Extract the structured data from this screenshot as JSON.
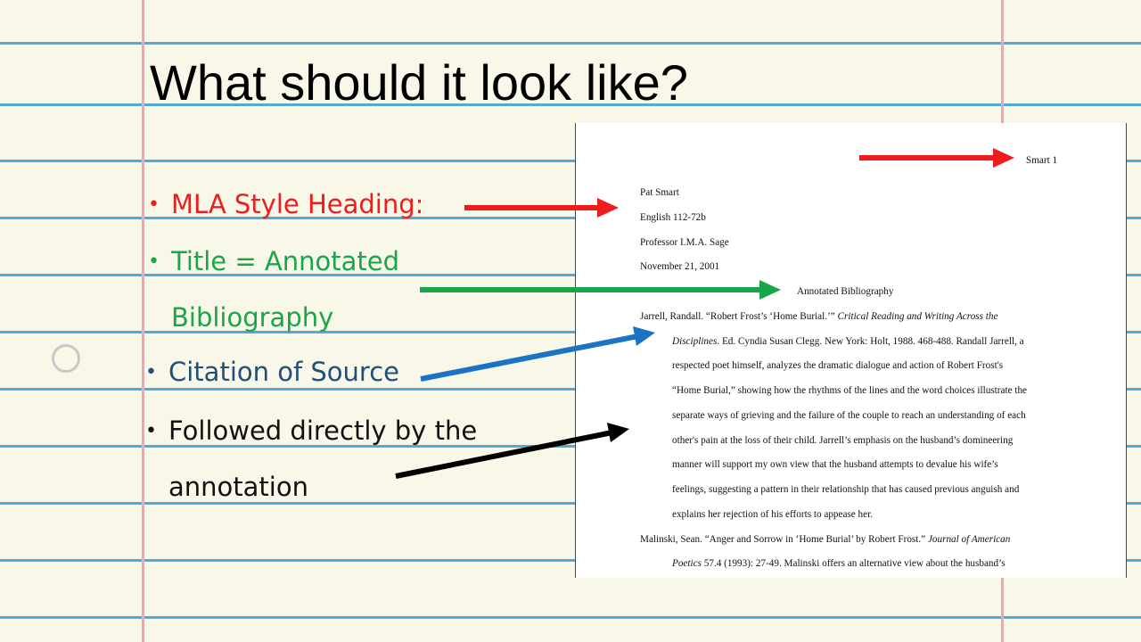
{
  "slide": {
    "title": "What should it look like?",
    "bullets": [
      {
        "label": "MLA Style Heading:",
        "color": "#ee1c1c"
      },
      {
        "label": "Title = Annotated",
        "color": "#1aa54a"
      },
      {
        "label": "Bibliography",
        "color": "#1aa54a"
      },
      {
        "label": "Citation of Source",
        "color": "#1f4f7a"
      },
      {
        "label": "Followed directly by the",
        "color": "#111111"
      },
      {
        "label": "annotation",
        "color": "#111111"
      }
    ]
  },
  "sample_page": {
    "page_header": "Smart 1",
    "heading_lines": [
      "Pat Smart",
      "English 112-72b",
      "Professor I.M.A. Sage",
      "November 21, 2001"
    ],
    "doc_title": "Annotated Bibliography",
    "entry1": {
      "first_plain": "Jarrell, Randall. “Robert Frost’s ‘Home Burial.’” ",
      "first_italic": "Critical Reading and Writing Across the",
      "second_italic": "Disciplines",
      "second_plain": ". Ed. Cyndia Susan Clegg. New York: Holt, 1988. 468-488. Randall Jarrell, a",
      "lines": [
        "respected poet himself, analyzes the dramatic dialogue and action of Robert Frost's",
        "“Home Burial,” showing how the rhythms of the lines and the word choices illustrate the",
        "separate ways of grieving and the failure of the couple to reach an understanding of each",
        "other's pain at the loss of their child. Jarrell’s emphasis on the husband’s domineering",
        "manner will support my own view that the husband attempts to devalue his wife’s",
        "feelings, suggesting a pattern in their relationship that has caused previous anguish and",
        "explains her rejection of his efforts to appease her."
      ]
    },
    "entry2": {
      "first_plain": "Malinski, Sean. “Anger and Sorrow in ‘Home Burial’ by Robert Frost.” ",
      "first_italic": "Journal of American",
      "second_italic": "Poetics",
      "second_plain": " 57.4 (1993): 27-49. Malinski offers an alternative view about the husband’s"
    }
  },
  "colors": {
    "background": "#f9f7e8",
    "rule_line": "#54a9d6",
    "margin_line": "#f0a6b2",
    "arrow_red": "#ee1c1c",
    "arrow_green": "#1aa54a",
    "arrow_blue": "#1a73c4",
    "arrow_black": "#000000"
  }
}
